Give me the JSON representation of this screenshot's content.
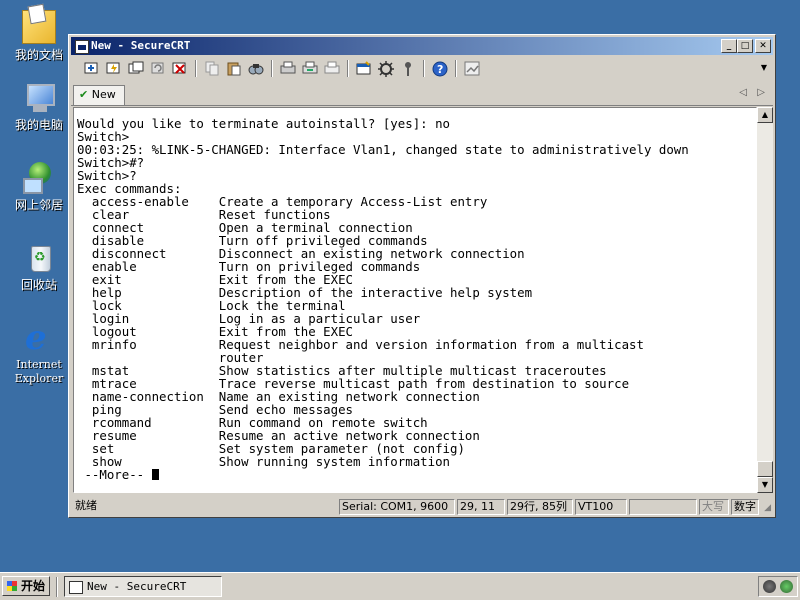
{
  "desktop": {
    "icons": [
      {
        "label": "我的文档",
        "icon": "my-documents-icon"
      },
      {
        "label": "我的电脑",
        "icon": "my-computer-icon"
      },
      {
        "label": "网上邻居",
        "icon": "network-places-icon"
      },
      {
        "label": "回收站",
        "icon": "recycle-bin-icon"
      },
      {
        "label": "Internet Explorer",
        "icon": "internet-explorer-icon"
      }
    ]
  },
  "window": {
    "title": "New - SecureCRT",
    "controls": {
      "minimize": "_",
      "maximize": "□",
      "close": "✕"
    }
  },
  "tabs": [
    {
      "label": "New"
    }
  ],
  "terminal": {
    "lines": [
      "Would you like to terminate autoinstall? [yes]: no",
      "Switch>",
      "00:03:25: %LINK-5-CHANGED: Interface Vlan1, changed state to administratively down",
      "Switch>#?",
      "Switch>?",
      "Exec commands:",
      "  access-enable    Create a temporary Access-List entry",
      "  clear            Reset functions",
      "  connect          Open a terminal connection",
      "  disable          Turn off privileged commands",
      "  disconnect       Disconnect an existing network connection",
      "  enable           Turn on privileged commands",
      "  exit             Exit from the EXEC",
      "  help             Description of the interactive help system",
      "  lock             Lock the terminal",
      "  login            Log in as a particular user",
      "  logout           Exit from the EXEC",
      "  mrinfo           Request neighbor and version information from a multicast",
      "                   router",
      "  mstat            Show statistics after multiple multicast traceroutes",
      "  mtrace           Trace reverse multicast path from destination to source",
      "  name-connection  Name an existing network connection",
      "  ping             Send echo messages",
      "  rcommand         Run command on remote switch",
      "  resume           Resume an active network connection",
      "  set              Set system parameter (not config)",
      "  show             Show running system information"
    ],
    "more_prompt": " --More-- "
  },
  "statusbar": {
    "ready": "就绪",
    "serial": "Serial: COM1, 9600",
    "position": "29,  11",
    "rowcol": "29行, 85列",
    "emulation": "VT100",
    "blank": "",
    "caps": "大写",
    "num": "数字"
  },
  "taskbar": {
    "start_label": "开始",
    "task_title": "New - SecureCRT"
  },
  "colors": {
    "desktop": "#3a6ea5",
    "titlebar_start": "#0a246a",
    "titlebar_end": "#a6caf0",
    "chrome": "#d4d0c8"
  }
}
